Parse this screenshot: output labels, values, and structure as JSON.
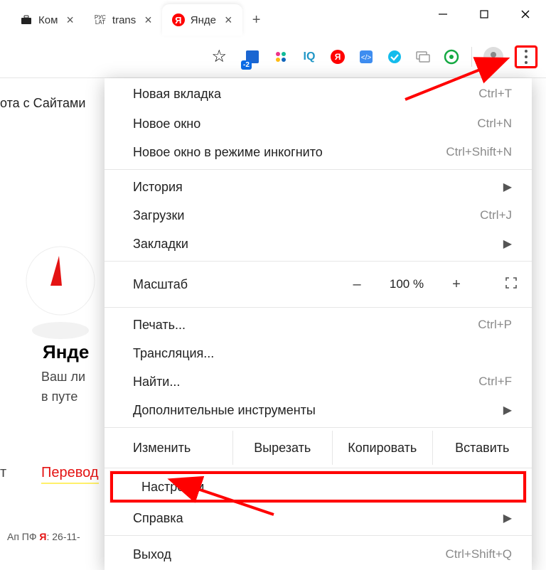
{
  "window": {
    "minimize": "–",
    "maximize": "□",
    "close": "✕"
  },
  "tabs": [
    {
      "title": "Ком",
      "favicon": "briefcase"
    },
    {
      "title": "trans",
      "favicon": "ruslat"
    },
    {
      "title": "Янде",
      "favicon": "yandex",
      "active": true
    }
  ],
  "toolbar": {
    "extensions": [
      {
        "name": "ext-a",
        "color": "#1b66d1",
        "badge": "-2"
      },
      {
        "name": "ext-colors",
        "color": "multi"
      },
      {
        "name": "ext-iq",
        "text": "IQ",
        "color": "#2096c6"
      },
      {
        "name": "ext-yandex",
        "color": "#ff0000"
      },
      {
        "name": "ext-code",
        "color": "#3e8df0"
      },
      {
        "name": "ext-check",
        "color": "#14bcec"
      },
      {
        "name": "ext-screens",
        "color": "#9a9a9a"
      },
      {
        "name": "ext-record",
        "color": "#14a942"
      }
    ]
  },
  "page": {
    "sites_label": "ота с Сайтами",
    "yandex_title": "Янде",
    "yandex_sub1": "Ваш ли",
    "yandex_sub2": "в путе",
    "trans_before": "т",
    "trans_link": "Перевод",
    "ap": {
      "prefix": "Ап ПФ ",
      "brand": "Я",
      "rest": ": 26-11-"
    }
  },
  "menu": {
    "new_tab": {
      "label": "Новая вкладка",
      "shortcut": "Ctrl+T"
    },
    "new_window": {
      "label": "Новое окно",
      "shortcut": "Ctrl+N"
    },
    "incognito": {
      "label": "Новое окно в режиме инкогнито",
      "shortcut": "Ctrl+Shift+N"
    },
    "history": {
      "label": "История"
    },
    "downloads": {
      "label": "Загрузки",
      "shortcut": "Ctrl+J"
    },
    "bookmarks": {
      "label": "Закладки"
    },
    "zoom": {
      "label": "Масштаб",
      "minus": "–",
      "value": "100 %",
      "plus": "+"
    },
    "print": {
      "label": "Печать...",
      "shortcut": "Ctrl+P"
    },
    "cast": {
      "label": "Трансляция..."
    },
    "find": {
      "label": "Найти...",
      "shortcut": "Ctrl+F"
    },
    "more_tools": {
      "label": "Дополнительные инструменты"
    },
    "edit": {
      "label": "Изменить",
      "cut": "Вырезать",
      "copy": "Копировать",
      "paste": "Вставить"
    },
    "settings": {
      "label": "Настройки"
    },
    "help": {
      "label": "Справка"
    },
    "exit": {
      "label": "Выход",
      "shortcut": "Ctrl+Shift+Q"
    }
  }
}
